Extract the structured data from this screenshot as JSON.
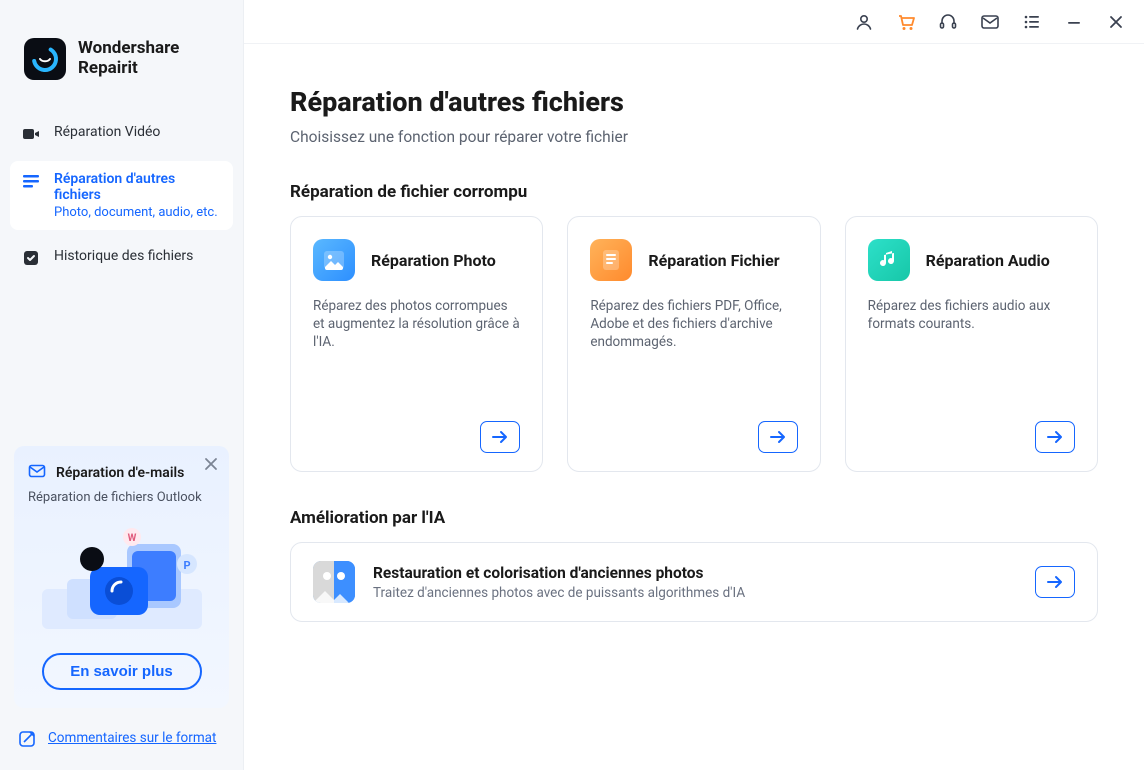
{
  "brand": {
    "line1": "Wondershare",
    "line2": "Repairit"
  },
  "sidebar": {
    "items": [
      {
        "label": "Réparation Vidéo",
        "sub": ""
      },
      {
        "label": "Réparation d'autres fichiers",
        "sub": "Photo, document, audio, etc."
      },
      {
        "label": "Historique des fichiers",
        "sub": ""
      }
    ]
  },
  "promo": {
    "title": "Réparation d'e-mails",
    "desc": "Réparation de fichiers Outlook",
    "cta": "En savoir plus"
  },
  "comments_link": "Commentaires sur le format",
  "page": {
    "title": "Réparation d'autres fichiers",
    "subtitle": "Choisissez une fonction pour réparer votre fichier",
    "section1": "Réparation de fichier corrompu",
    "section2": "Amélioration par l'IA"
  },
  "cards": [
    {
      "title": "Réparation Photo",
      "desc": "Réparez des photos corrompues et augmentez la résolution grâce à l'IA."
    },
    {
      "title": "Réparation Fichier",
      "desc": "Réparez des fichiers PDF, Office, Adobe et des fichiers d'archive endommagés."
    },
    {
      "title": "Réparation Audio",
      "desc": "Réparez des fichiers audio aux formats courants."
    }
  ],
  "aicard": {
    "title": "Restauration et colorisation d'anciennes photos",
    "desc": "Traitez d'anciennes photos avec de puissants algorithmes d'IA"
  },
  "colors": {
    "accent": "#1566ff",
    "cart": "#ff8a2d"
  }
}
